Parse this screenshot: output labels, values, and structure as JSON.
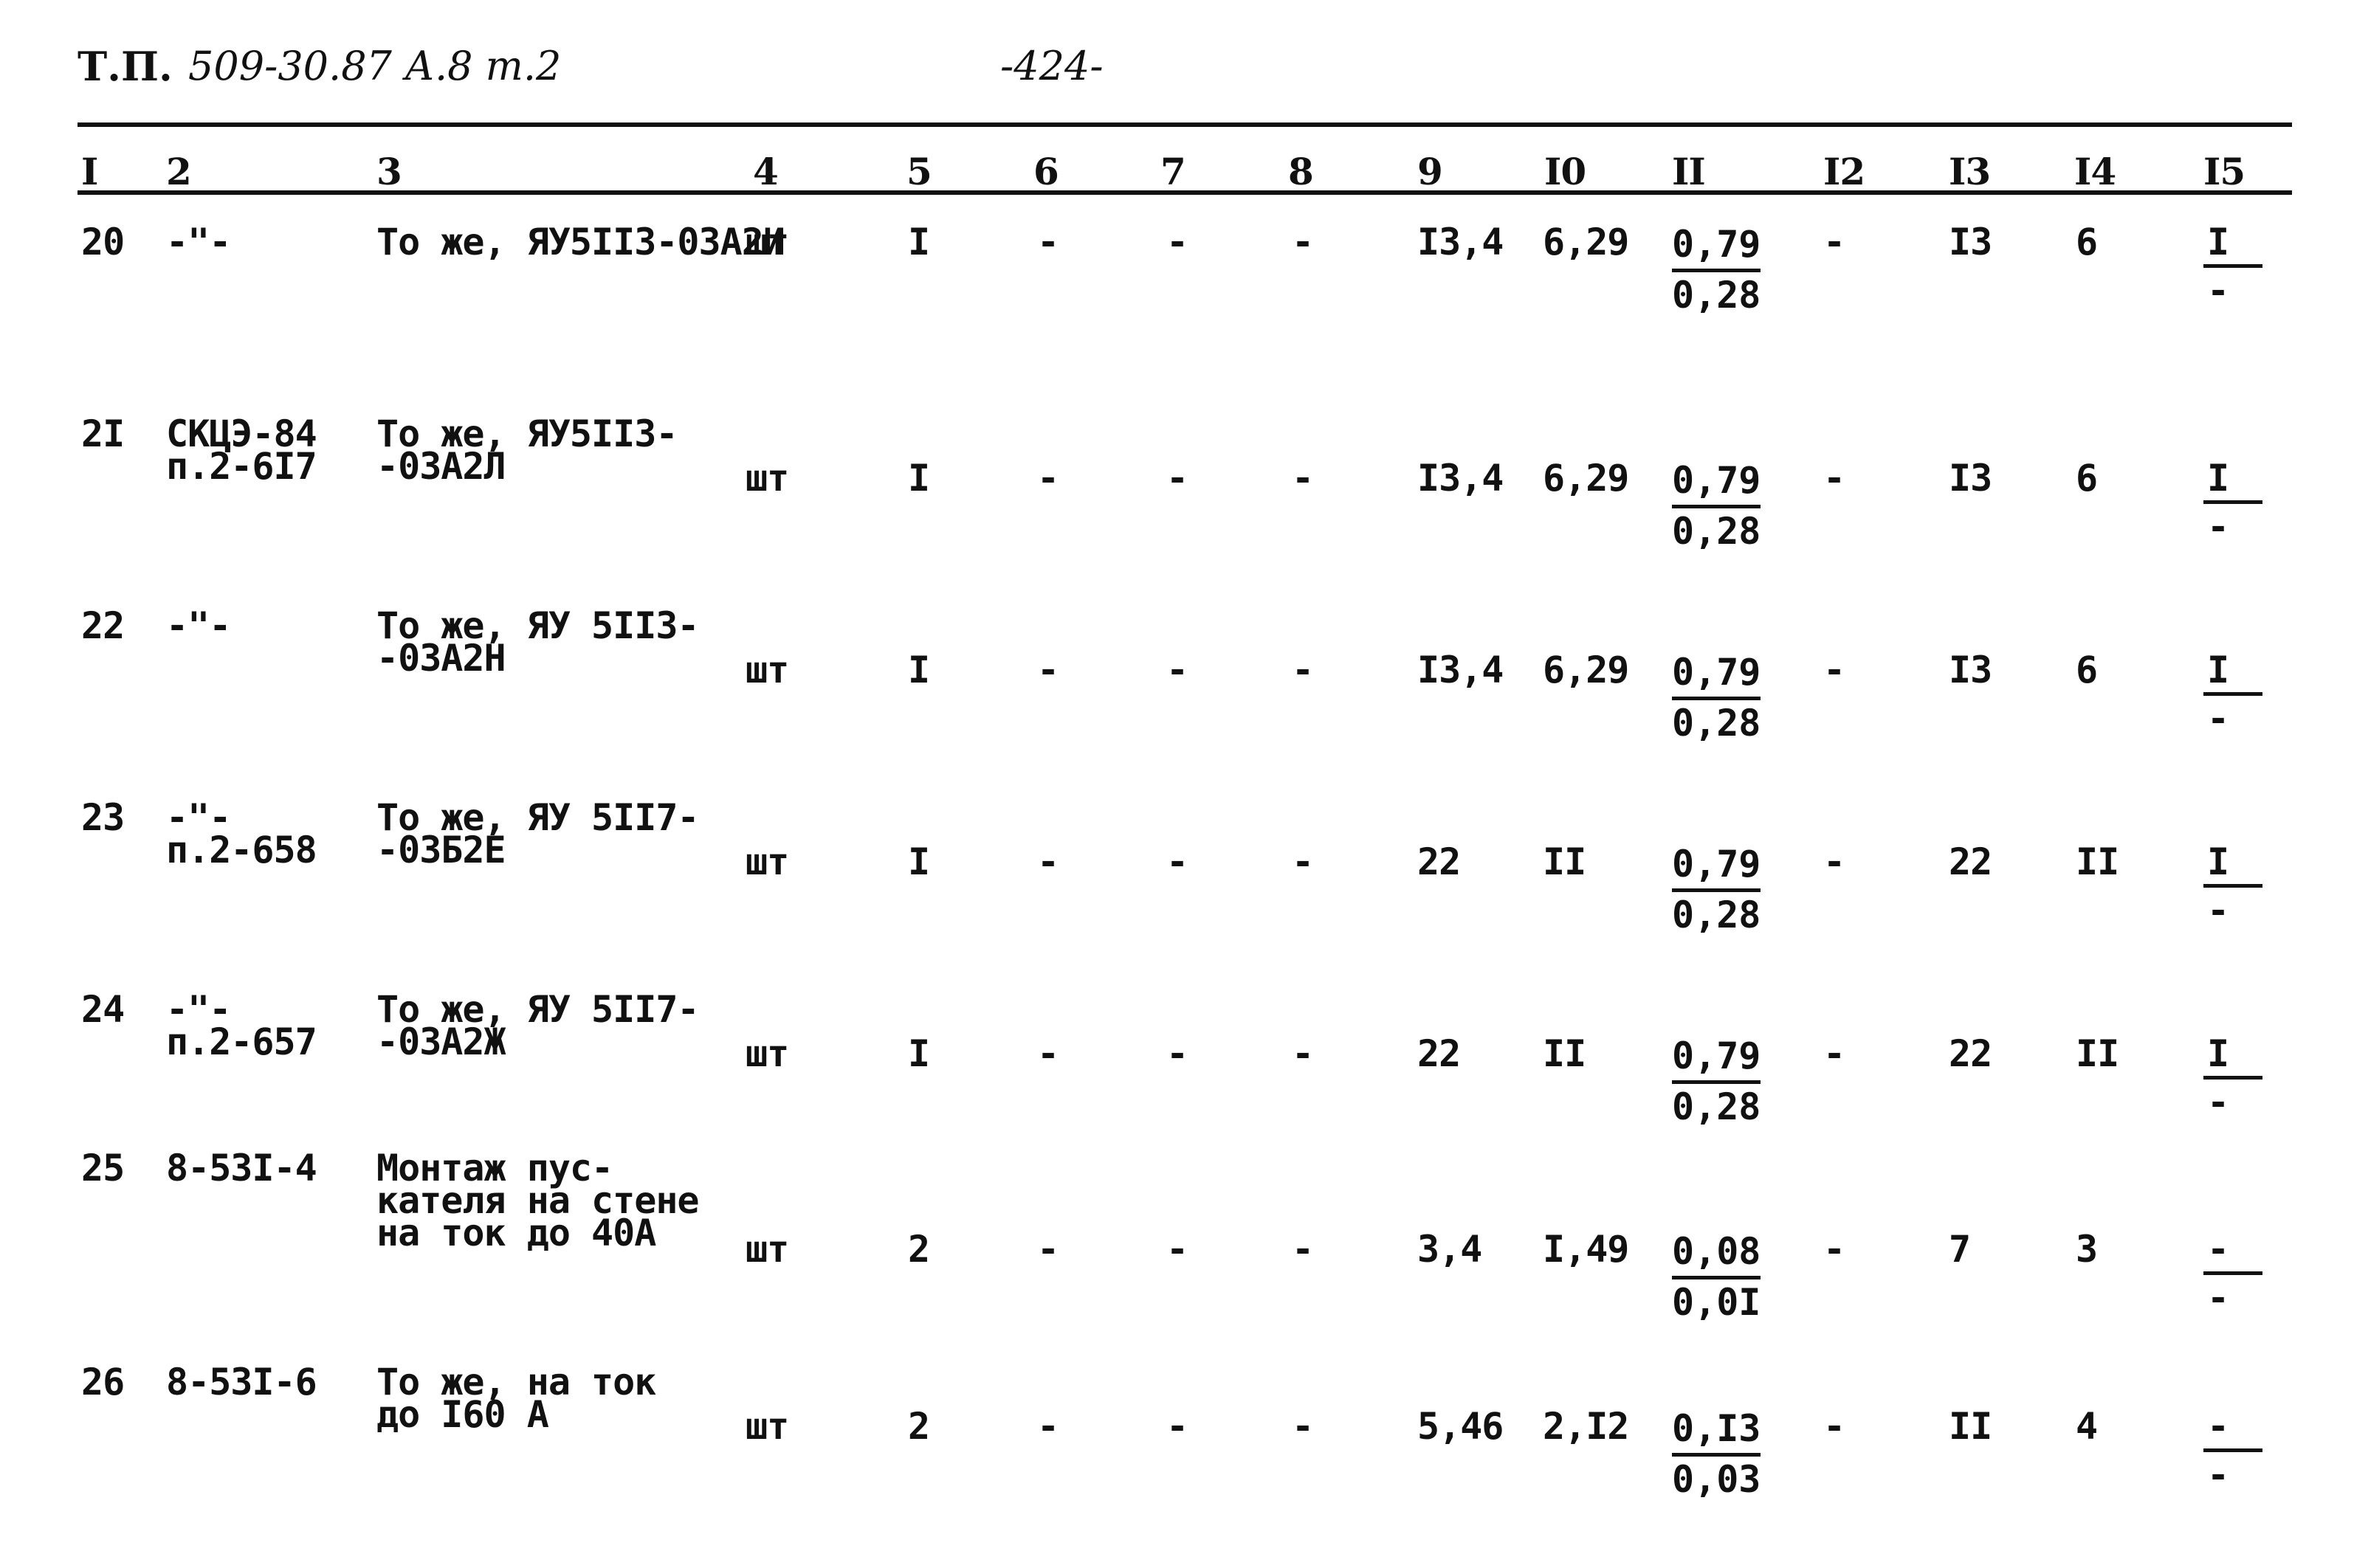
{
  "header": {
    "doc_code_printed": "Т.П.",
    "doc_code_hand": "509-30.87 А.8 т.2",
    "page_number": "-424-"
  },
  "columns": [
    "I",
    "2",
    "3",
    "4",
    "5",
    "6",
    "7",
    "8",
    "9",
    "I0",
    "II",
    "I2",
    "I3",
    "I4",
    "I5"
  ],
  "rows": [
    {
      "n": "20",
      "ref": [
        "-\"-"
      ],
      "desc": [
        "То же, ЯУ5II3-03А2И"
      ],
      "unit": "шт",
      "qty": "I",
      "c6": "-",
      "c7": "-",
      "c8": "-",
      "c9": "I3,4",
      "c10": "6,29",
      "c11_top": "0,79",
      "c11_bot": "0,28",
      "c12": "-",
      "c13": "I3",
      "c14": "6",
      "c15_top": "I",
      "c15_bot": "-"
    },
    {
      "n": "2I",
      "ref": [
        "СКЦЭ-84",
        "п.2-6I7"
      ],
      "desc": [
        "То же, ЯУ5II3-",
        "-03А2Л"
      ],
      "unit": "шт",
      "qty": "I",
      "c6": "-",
      "c7": "-",
      "c8": "-",
      "c9": "I3,4",
      "c10": "6,29",
      "c11_top": "0,79",
      "c11_bot": "0,28",
      "c12": "-",
      "c13": "I3",
      "c14": "6",
      "c15_top": "I",
      "c15_bot": "-"
    },
    {
      "n": "22",
      "ref": [
        "-\"-"
      ],
      "desc": [
        "То же, ЯУ 5II3-",
        "-03А2Н"
      ],
      "unit": "шт",
      "qty": "I",
      "c6": "-",
      "c7": "-",
      "c8": "-",
      "c9": "I3,4",
      "c10": "6,29",
      "c11_top": "0,79",
      "c11_bot": "0,28",
      "c12": "-",
      "c13": "I3",
      "c14": "6",
      "c15_top": "I",
      "c15_bot": "-"
    },
    {
      "n": "23",
      "ref": [
        "-\"-",
        "п.2-658"
      ],
      "desc": [
        "То же, ЯУ 5II7-",
        "-03Б2Е"
      ],
      "unit": "шт",
      "qty": "I",
      "c6": "-",
      "c7": "-",
      "c8": "-",
      "c9": "22",
      "c10": "II",
      "c11_top": "0,79",
      "c11_bot": "0,28",
      "c12": "-",
      "c13": "22",
      "c14": "II",
      "c15_top": "I",
      "c15_bot": "-"
    },
    {
      "n": "24",
      "ref": [
        "-\"-",
        "п.2-657"
      ],
      "desc": [
        "То же, ЯУ 5II7-",
        "-03А2Ж"
      ],
      "unit": "шт",
      "qty": "I",
      "c6": "-",
      "c7": "-",
      "c8": "-",
      "c9": "22",
      "c10": "II",
      "c11_top": "0,79",
      "c11_bot": "0,28",
      "c12": "-",
      "c13": "22",
      "c14": "II",
      "c15_top": "I",
      "c15_bot": "-"
    },
    {
      "n": "25",
      "ref": [
        "8-53I-4"
      ],
      "desc": [
        "Монтаж пус-",
        "кателя на стене",
        "на ток до 40А"
      ],
      "unit": "шт",
      "qty": "2",
      "c6": "-",
      "c7": "-",
      "c8": "-",
      "c9": "3,4",
      "c10": "I,49",
      "c11_top": "0,08",
      "c11_bot": "0,0I",
      "c12": "-",
      "c13": "7",
      "c14": "3",
      "c15_top": "-",
      "c15_bot": "-"
    },
    {
      "n": "26",
      "ref": [
        "8-53I-6"
      ],
      "desc": [
        "То же, на ток",
        "до I60 А"
      ],
      "unit": "шт",
      "qty": "2",
      "c6": "-",
      "c7": "-",
      "c8": "-",
      "c9": "5,46",
      "c10": "2,I2",
      "c11_top": "0,I3",
      "c11_bot": "0,03",
      "c12": "-",
      "c13": "II",
      "c14": "4",
      "c15_top": "-",
      "c15_bot": "-"
    }
  ]
}
